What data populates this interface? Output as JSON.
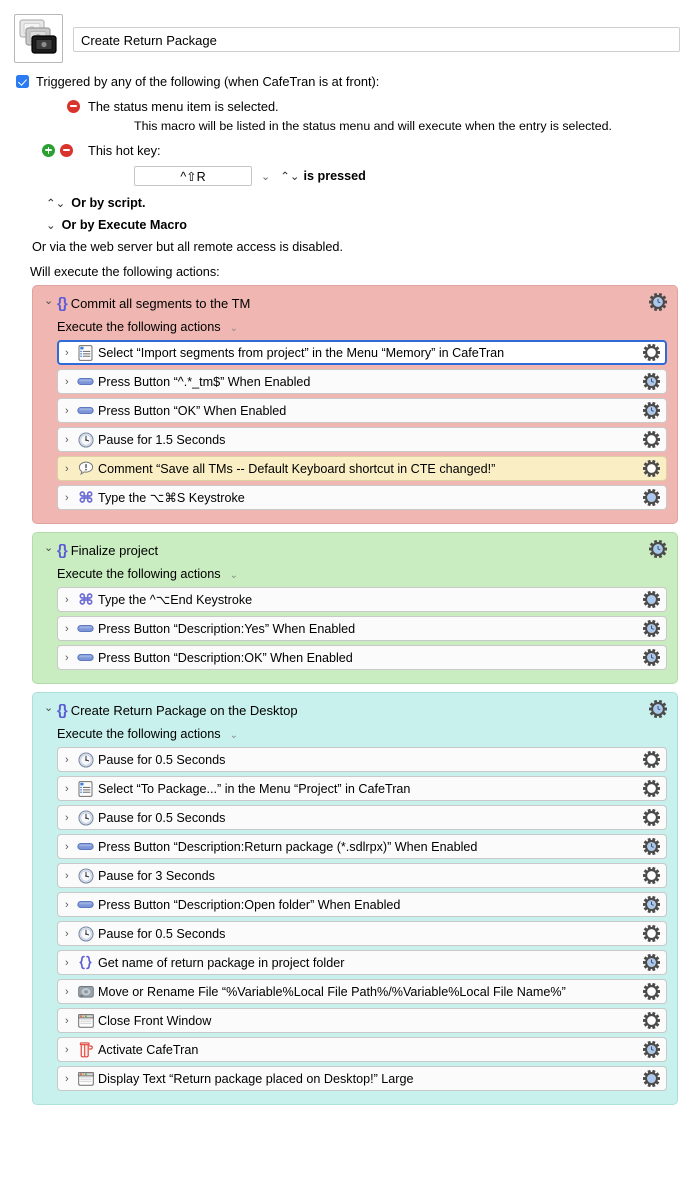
{
  "macro": {
    "title": "Create Return Package",
    "icon": "macro-group-stack-icon"
  },
  "trigger_section": {
    "checkbox_label": "Triggered by any of the following (when CafeTran is at front):",
    "triggers": [
      {
        "id": "status-menu",
        "label": "The status menu item is selected.",
        "note": "This macro will be listed in the status menu and will execute when the entry is selected.",
        "has_add": false,
        "has_remove": true
      },
      {
        "id": "hot-key",
        "label": "This hot key:",
        "has_add": true,
        "has_remove": true,
        "hotkey_value": "^⇧R",
        "suffix": "is pressed"
      }
    ],
    "or_by_script": "Or by script.",
    "or_by_execute_macro": "Or by Execute Macro",
    "web_server_note": "Or via the web server but all remote access is disabled."
  },
  "actions_header": "Will execute the following actions:",
  "groups": [
    {
      "title": "Commit all segments to the TM",
      "color": "#f0b7b2",
      "border": "#e0a49f",
      "subtitle": "Execute the following actions",
      "gear_badge": "clock",
      "actions": [
        {
          "icon": "menu-select-icon",
          "text": "Select “Import segments from project” in the Menu “Memory” in CafeTran",
          "selected": true,
          "gear_badge": "none",
          "style": "normal"
        },
        {
          "icon": "press-button-icon",
          "text": "Press Button “^.*_tm$” When Enabled",
          "selected": false,
          "gear_badge": "clock",
          "style": "normal"
        },
        {
          "icon": "press-button-icon",
          "text": "Press Button “OK” When Enabled",
          "selected": false,
          "gear_badge": "clock",
          "style": "normal"
        },
        {
          "icon": "clock-icon",
          "text": "Pause for 1.5 Seconds",
          "selected": false,
          "gear_badge": "none",
          "style": "normal"
        },
        {
          "icon": "comment-icon",
          "text": "Comment “Save all TMs -- Default Keyboard shortcut in CTE changed!”",
          "selected": false,
          "gear_badge": "none",
          "style": "comment"
        },
        {
          "icon": "keystroke-icon",
          "text": "Type the ⌥⌘S Keystroke",
          "selected": false,
          "gear_badge": "dot",
          "style": "normal"
        }
      ]
    },
    {
      "title": "Finalize project",
      "color": "#c9ecc0",
      "border": "#b4dcaa",
      "subtitle": "Execute the following actions",
      "gear_badge": "clock",
      "actions": [
        {
          "icon": "keystroke-icon",
          "text": "Type the ^⌥End Keystroke",
          "selected": false,
          "gear_badge": "dot",
          "style": "normal"
        },
        {
          "icon": "press-button-icon",
          "text": "Press Button “Description:Yes” When Enabled",
          "selected": false,
          "gear_badge": "clock",
          "style": "normal"
        },
        {
          "icon": "press-button-icon",
          "text": "Press Button “Description:OK” When Enabled",
          "selected": false,
          "gear_badge": "clock",
          "style": "normal"
        }
      ]
    },
    {
      "title": "Create Return Package on the Desktop",
      "color": "#c8f0ec",
      "border": "#aee0db",
      "subtitle": "Execute the following actions",
      "gear_badge": "clock",
      "actions": [
        {
          "icon": "clock-icon",
          "text": "Pause for 0.5 Seconds",
          "selected": false,
          "gear_badge": "none",
          "style": "normal"
        },
        {
          "icon": "menu-select-icon",
          "text": "Select “To Package...” in the Menu “Project” in CafeTran",
          "selected": false,
          "gear_badge": "none",
          "style": "normal"
        },
        {
          "icon": "clock-icon",
          "text": "Pause for 0.5 Seconds",
          "selected": false,
          "gear_badge": "none",
          "style": "normal"
        },
        {
          "icon": "press-button-icon",
          "text": "Press Button “Description:Return package (*.sdlrpx)” When Enabled",
          "selected": false,
          "gear_badge": "clock",
          "style": "normal"
        },
        {
          "icon": "clock-icon",
          "text": "Pause for 3 Seconds",
          "selected": false,
          "gear_badge": "none",
          "style": "normal"
        },
        {
          "icon": "press-button-icon",
          "text": "Press Button “Description:Open folder” When Enabled",
          "selected": false,
          "gear_badge": "clock",
          "style": "normal"
        },
        {
          "icon": "clock-icon",
          "text": "Pause for 0.5 Seconds",
          "selected": false,
          "gear_badge": "none",
          "style": "normal"
        },
        {
          "icon": "braces-icon",
          "text": "Get name of return package in project folder",
          "selected": false,
          "gear_badge": "clock",
          "style": "normal"
        },
        {
          "icon": "disk-icon",
          "text": "Move or Rename File “%Variable%Local File Path%/%Variable%Local File Name%”",
          "selected": false,
          "gear_badge": "none",
          "style": "normal"
        },
        {
          "icon": "window-icon",
          "text": "Close Front Window",
          "selected": false,
          "gear_badge": "none",
          "style": "normal"
        },
        {
          "icon": "cafetran-icon",
          "text": "Activate CafeTran",
          "selected": false,
          "gear_badge": "clock",
          "style": "normal"
        },
        {
          "icon": "window-icon",
          "text": "Display Text “Return package placed on Desktop!” Large",
          "selected": false,
          "gear_badge": "dot",
          "style": "normal"
        }
      ]
    }
  ],
  "colors": {
    "accent_blue": "#2b7bf3",
    "selection_blue": "#2f6ad9",
    "group_pink": "#f0b7b2",
    "group_green": "#c9ecc0",
    "group_teal": "#c8f0ec",
    "comment_yellow": "#faeec4",
    "remove_red": "#d9342b",
    "add_green": "#2aa033",
    "braces_purple": "#5b5bd6"
  }
}
